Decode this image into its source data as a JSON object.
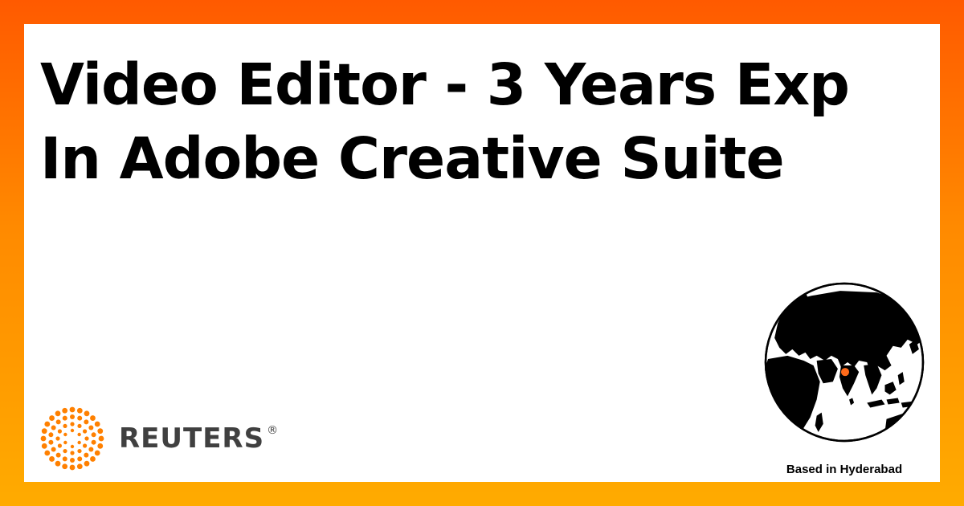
{
  "headline": {
    "line1": "Video Editor - 3 Years Exp",
    "line2": "In Adobe Creative Suite"
  },
  "logo": {
    "wordmark": "REUTERS",
    "registered": "®",
    "icon": "reuters-dot-ring-logo"
  },
  "location": {
    "label": "Based in Hyderabad",
    "icon": "globe-icon",
    "marker_icon": "location-pin-icon"
  },
  "colors": {
    "background_top": "#ff5a00",
    "background_bottom": "#ffab00",
    "card": "#ffffff",
    "text": "#000000",
    "brand": "#ff8000",
    "wordmark": "#404040",
    "marker": "#ff6a1a"
  }
}
